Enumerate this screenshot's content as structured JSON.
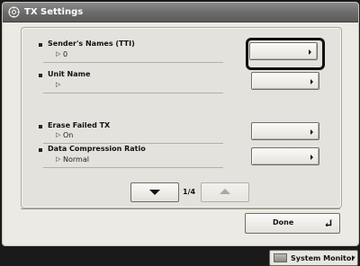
{
  "window": {
    "title": "TX Settings",
    "title_icon": "gear-wrench-icon"
  },
  "settings": {
    "items": [
      {
        "label": "Sender's Names (TTI)",
        "value": "0"
      },
      {
        "label": "Unit Name",
        "value": ""
      },
      {
        "label": "Erase Failed TX",
        "value": "On"
      },
      {
        "label": "Data Compression Ratio",
        "value": "Normal"
      }
    ]
  },
  "pager": {
    "indicator": "1/4"
  },
  "actions": {
    "done_label": "Done"
  },
  "statusbar": {
    "system_monitor_label": "System Monitor"
  }
}
